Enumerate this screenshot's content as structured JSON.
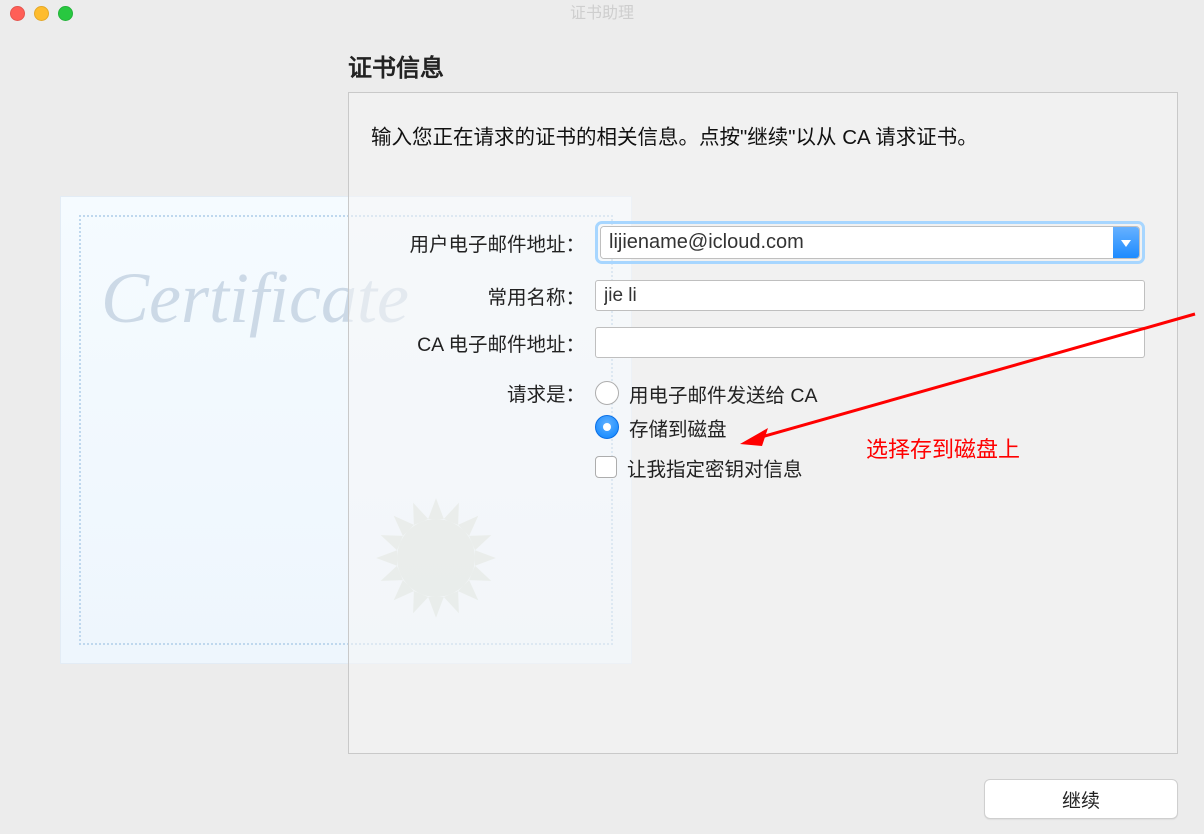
{
  "window_title": "证书助理",
  "heading": "证书信息",
  "instructions": "输入您正在请求的证书的相关信息。点按\"继续\"以从 CA 请求证书。",
  "field_labels": {
    "email": "用户电子邮件地址：",
    "name": "常用名称：",
    "ca_email": "CA 电子邮件地址：",
    "request": "请求是："
  },
  "field_values": {
    "email": "lijiename@icloud.com",
    "name": "jie li",
    "ca_email": ""
  },
  "options": {
    "send_email": "用电子邮件发送给 CA",
    "save_disk": "存储到磁盘",
    "specify_key": "让我指定密钥对信息"
  },
  "continue_btn": "继续",
  "cert_word": "Certificate",
  "annotation": "选择存到磁盘上"
}
